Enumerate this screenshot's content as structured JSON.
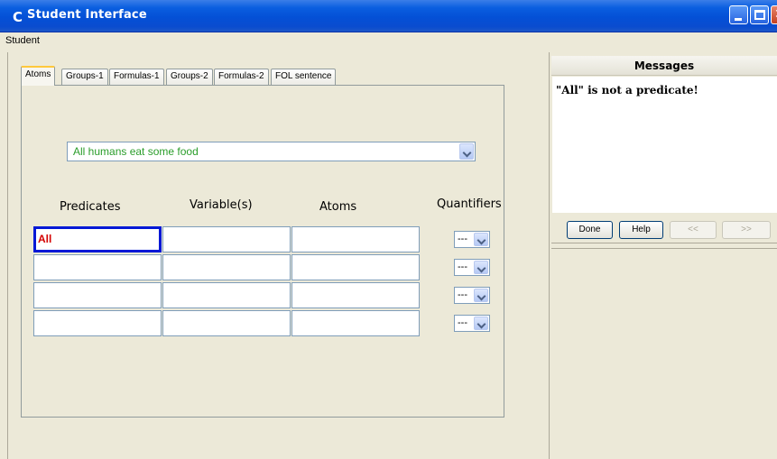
{
  "window": {
    "app_icon": "C",
    "title": "Student Interface",
    "title_color": "#0a5ee0"
  },
  "menu": {
    "items": [
      "Student"
    ]
  },
  "tabs": [
    {
      "label": "Atoms",
      "active": true
    },
    {
      "label": "Groups-1",
      "active": false
    },
    {
      "label": "Formulas-1",
      "active": false
    },
    {
      "label": "Groups-2",
      "active": false
    },
    {
      "label": "Formulas-2",
      "active": false
    },
    {
      "label": "FOL sentence",
      "active": false
    }
  ],
  "sentence_select": {
    "selected": "All humans eat some food",
    "text_color": "#2a9d2a"
  },
  "table": {
    "headers": {
      "predicates": "Predicates",
      "variables": "Variable(s)",
      "atoms": "Atoms",
      "quantifiers": "Quantifiers"
    },
    "rows": [
      {
        "predicate": "All",
        "variables": "",
        "atoms": "",
        "quantifier": "---"
      },
      {
        "predicate": "",
        "variables": "",
        "atoms": "",
        "quantifier": "---"
      },
      {
        "predicate": "",
        "variables": "",
        "atoms": "",
        "quantifier": "---"
      },
      {
        "predicate": "",
        "variables": "",
        "atoms": "",
        "quantifier": "---"
      }
    ]
  },
  "messages": {
    "header": "Messages",
    "text": "\"All\" is not a predicate!"
  },
  "buttons": {
    "done": "Done",
    "help": "Help",
    "prev": "<<",
    "next": ">>"
  },
  "icons": {
    "minimize": "minimize-icon",
    "maximize": "maximize-icon",
    "close": "close-icon",
    "dropdown": "chevron-down-icon"
  }
}
